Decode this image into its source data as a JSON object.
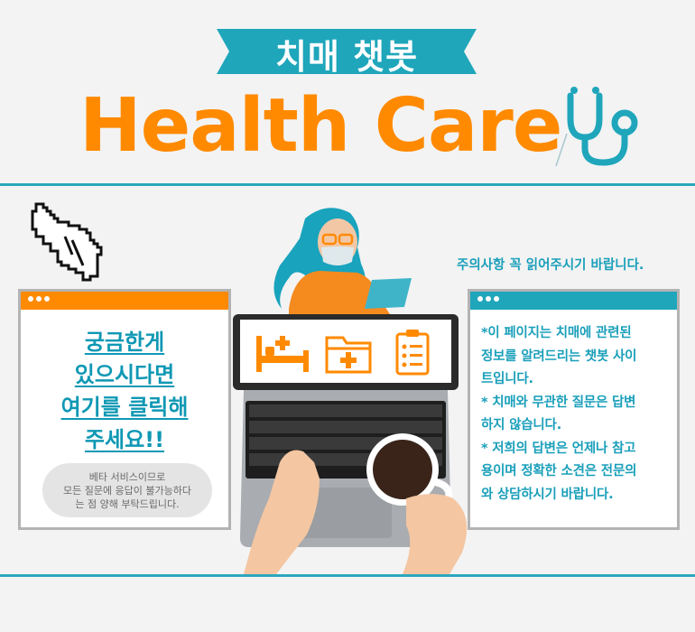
{
  "banner": {
    "title": "치매 챗봇"
  },
  "hero": {
    "title": "Health Care"
  },
  "icons": {
    "stethoscope": "stethoscope-icon",
    "pointer": "pointing-hand-icon",
    "bed": "hospital-bed-icon",
    "folder": "medical-folder-icon",
    "clipboard": "clipboard-icon"
  },
  "left_panel": {
    "cta_lines": [
      "궁금한게",
      "있으시다면",
      "여기를 클릭해",
      "주세요!!"
    ],
    "beta_lines": [
      "베타 서비스이므로",
      "모든 질문에 응답이 불가능하다",
      "는 점 양해 부탁드립니다."
    ]
  },
  "notice": "주의사항 꼭 읽어주시기 바랍니다.",
  "right_panel": {
    "lines": [
      "*이 페이지는 치매에 관련된",
      "정보를 알려드리는 챗봇 사이",
      "트입니다.",
      "* 치매와 무관한 질문은 답변",
      "하지 않습니다.",
      "* 저희의 답변은 언제나 참고",
      "용이며 정확한 소견은 전문의",
      "와 상담하시기 바랍니다."
    ]
  },
  "colors": {
    "teal": "#1fa6bb",
    "orange": "#ff8a00",
    "background": "#f3f3f3"
  }
}
